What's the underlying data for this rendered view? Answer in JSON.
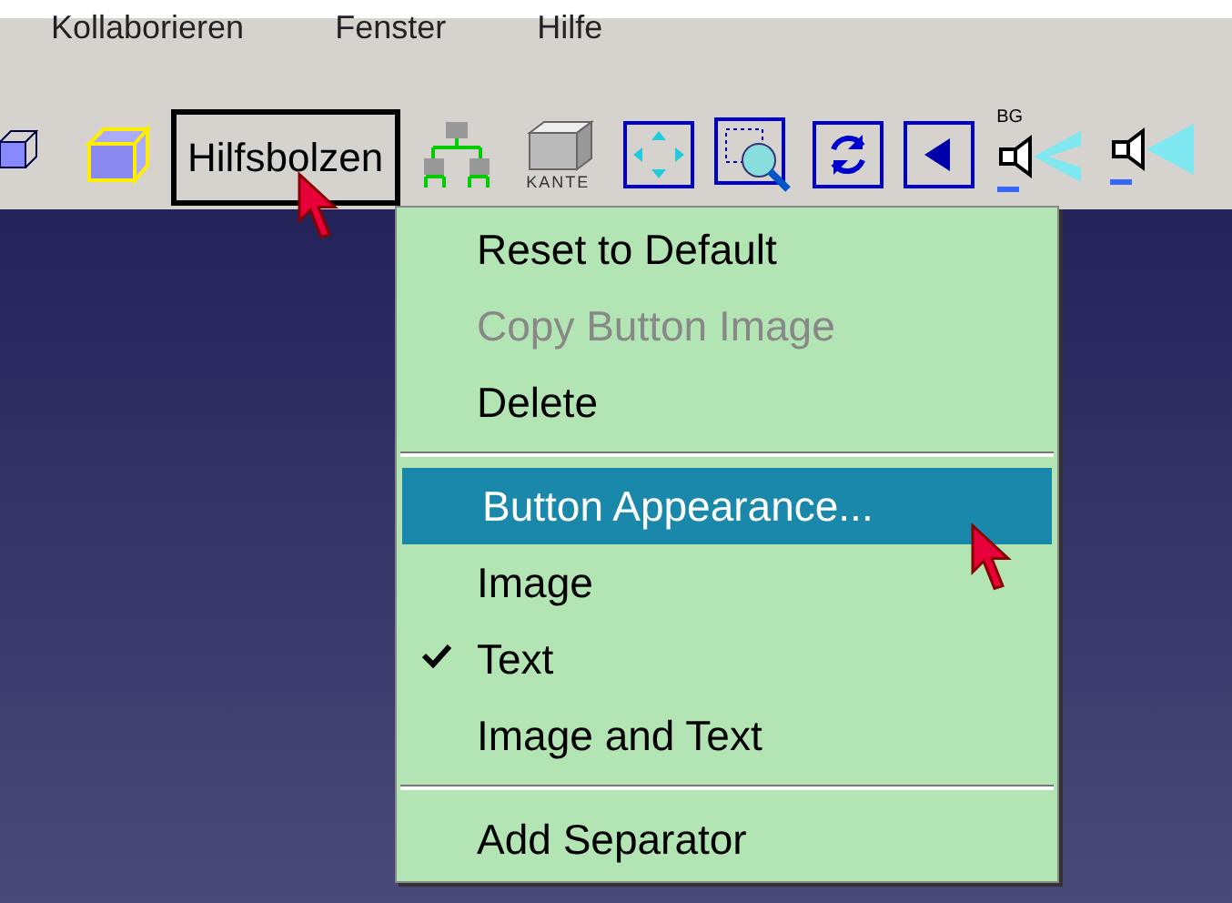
{
  "menu_bar": [
    "Kollaborieren",
    "Fenster",
    "Hilfe"
  ],
  "toolbar": {
    "button": "Hilfsbolzen",
    "edge_label": "KANTE",
    "bg_label": "BG"
  },
  "context_menu": [
    {
      "kind": "item",
      "label": "Reset to Default",
      "disabled": false,
      "selected": false,
      "checked": false
    },
    {
      "kind": "item",
      "label": "Copy Button Image",
      "disabled": true,
      "selected": false,
      "checked": false
    },
    {
      "kind": "item",
      "label": "Delete",
      "disabled": false,
      "selected": false,
      "checked": false
    },
    {
      "kind": "separator"
    },
    {
      "kind": "item",
      "label": "Button Appearance...",
      "disabled": false,
      "selected": true,
      "checked": false
    },
    {
      "kind": "item",
      "label": "Image",
      "disabled": false,
      "selected": false,
      "checked": false
    },
    {
      "kind": "item",
      "label": "Text",
      "disabled": false,
      "selected": false,
      "checked": true
    },
    {
      "kind": "item",
      "label": "Image and Text",
      "disabled": false,
      "selected": false,
      "checked": false
    },
    {
      "kind": "separator"
    },
    {
      "kind": "item",
      "label": "Add Separator",
      "disabled": false,
      "selected": false,
      "checked": false
    }
  ]
}
